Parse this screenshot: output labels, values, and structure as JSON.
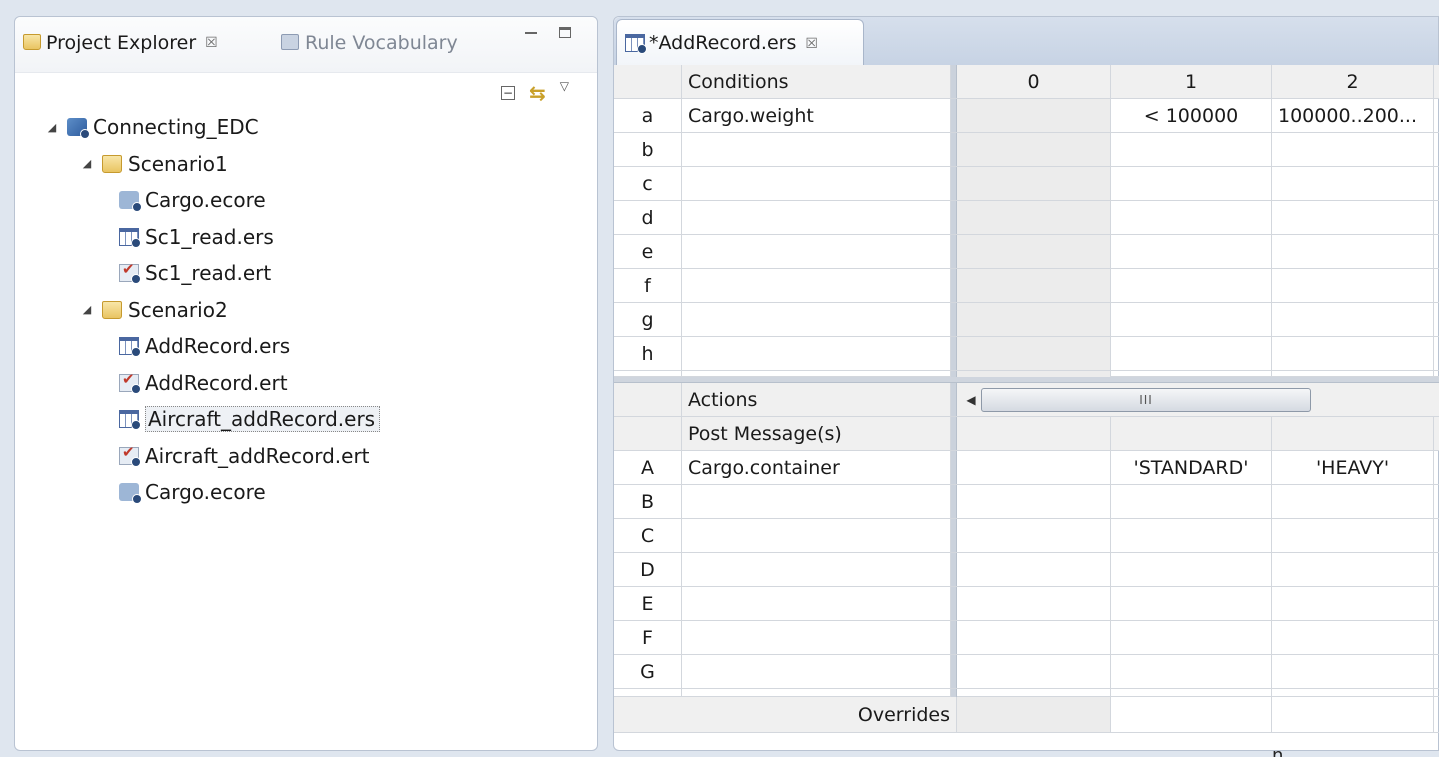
{
  "project_explorer": {
    "tab_title": "Project Explorer",
    "tab_close": "☒",
    "second_tab": "Rule Vocabulary",
    "tree": [
      {
        "label": "Connecting_EDC",
        "icon": "project-icon",
        "level": 0,
        "expanded": true
      },
      {
        "label": "Scenario1",
        "icon": "folder-icon",
        "level": 1,
        "expanded": true
      },
      {
        "label": "Cargo.ecore",
        "icon": "ecore-file-icon",
        "level": 2
      },
      {
        "label": "Sc1_read.ers",
        "icon": "ers-file-icon",
        "level": 2
      },
      {
        "label": "Sc1_read.ert",
        "icon": "ert-file-icon",
        "level": 2
      },
      {
        "label": "Scenario2",
        "icon": "folder-icon",
        "level": 1,
        "expanded": true
      },
      {
        "label": "AddRecord.ers",
        "icon": "ers-file-icon",
        "level": 2
      },
      {
        "label": "AddRecord.ert",
        "icon": "ert-file-icon",
        "level": 2
      },
      {
        "label": "Aircraft_addRecord.ers",
        "icon": "ers-file-icon",
        "level": 2,
        "selected": true
      },
      {
        "label": "Aircraft_addRecord.ert",
        "icon": "ert-file-icon",
        "level": 2
      },
      {
        "label": "Cargo.ecore",
        "icon": "ecore-file-icon",
        "level": 2
      }
    ]
  },
  "editor": {
    "tab_title": "*AddRecord.ers",
    "tab_close": "☒",
    "conditions_header": "Conditions",
    "column_headers": [
      "0",
      "1",
      "2"
    ],
    "condition_rows": [
      {
        "letter": "a",
        "label": "Cargo.weight",
        "v1": "< 100000",
        "v2": "100000..200..."
      },
      {
        "letter": "b",
        "label": "",
        "v1": "",
        "v2": ""
      },
      {
        "letter": "c",
        "label": "",
        "v1": "",
        "v2": ""
      },
      {
        "letter": "d",
        "label": "",
        "v1": "",
        "v2": ""
      },
      {
        "letter": "e",
        "label": "",
        "v1": "",
        "v2": ""
      },
      {
        "letter": "f",
        "label": "",
        "v1": "",
        "v2": ""
      },
      {
        "letter": "g",
        "label": "",
        "v1": "",
        "v2": ""
      },
      {
        "letter": "h",
        "label": "",
        "v1": "",
        "v2": ""
      }
    ],
    "actions_header": "Actions",
    "scrollbar_grip": "III",
    "post_messages": "Post Message(s)",
    "action_rows": [
      {
        "letter": "A",
        "label": "Cargo.container",
        "v1": "'STANDARD'",
        "v2": "'HEAVY'"
      },
      {
        "letter": "B",
        "label": "",
        "v1": "",
        "v2": ""
      },
      {
        "letter": "C",
        "label": "",
        "v1": "",
        "v2": ""
      },
      {
        "letter": "D",
        "label": "",
        "v1": "",
        "v2": ""
      },
      {
        "letter": "E",
        "label": "",
        "v1": "",
        "v2": ""
      },
      {
        "letter": "F",
        "label": "",
        "v1": "",
        "v2": ""
      },
      {
        "letter": "G",
        "label": "",
        "v1": "",
        "v2": ""
      }
    ],
    "overrides_label": "Overrides"
  },
  "stray_text": "n"
}
